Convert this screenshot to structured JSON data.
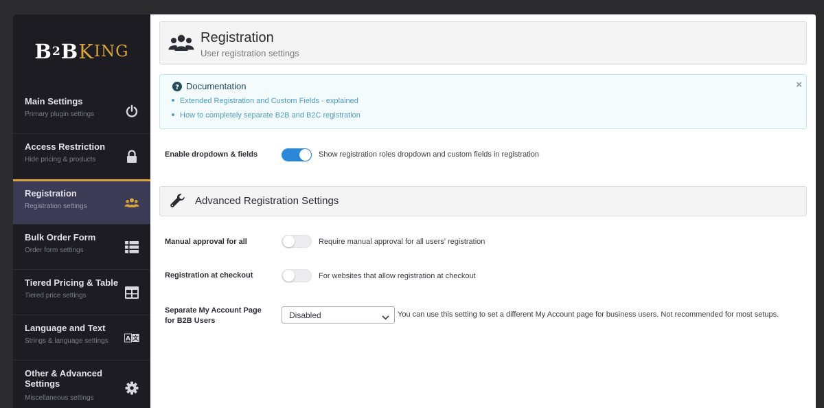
{
  "logo": {
    "b": "B",
    "two": "2",
    "b2": "B",
    "k": "K",
    "ing": "ING"
  },
  "sidebar": {
    "items": [
      {
        "title": "Main Settings",
        "subtitle": "Primary plugin settings",
        "icon": "power-icon"
      },
      {
        "title": "Access Restriction",
        "subtitle": "Hide pricing & products",
        "icon": "lock-icon"
      },
      {
        "title": "Registration",
        "subtitle": "Registration settings",
        "icon": "users-icon",
        "active": true
      },
      {
        "title": "Bulk Order Form",
        "subtitle": "Order form settings",
        "icon": "list-icon"
      },
      {
        "title": "Tiered Pricing & Table",
        "subtitle": "Tiered price settings",
        "icon": "table-icon"
      },
      {
        "title": "Language and Text",
        "subtitle": "Strings & language settings",
        "icon": "translate-icon"
      },
      {
        "title": "Other & Advanced Settings",
        "subtitle": "Miscellaneous settings",
        "icon": "gear-icon"
      }
    ]
  },
  "header": {
    "title": "Registration",
    "subtitle": "User registration settings",
    "icon": "users-icon"
  },
  "documentation": {
    "title": "Documentation",
    "close": "×",
    "links": [
      "Extended Registration and Custom Fields - explained",
      "How to completely separate B2B and B2C registration"
    ]
  },
  "settings": {
    "enable_dropdown": {
      "label": "Enable dropdown & fields",
      "enabled": true,
      "description": "Show registration roles dropdown and custom fields in registration"
    },
    "manual_approval": {
      "label": "Manual approval for all",
      "enabled": false,
      "description": "Require manual approval for all users' registration"
    },
    "registration_checkout": {
      "label": "Registration at checkout",
      "enabled": false,
      "description": "For websites that allow registration at checkout"
    },
    "separate_account": {
      "label_line1": "Separate My Account Page",
      "label_line2": "for B2B Users",
      "selected": "Disabled",
      "description": "You can use this setting to set a different My Account page for business users. Not recommended for most setups."
    }
  },
  "advanced": {
    "title": "Advanced Registration Settings",
    "icon": "wrench-icon"
  },
  "colors": {
    "accent": "#d9a53c",
    "toggle_on": "#2b88d8",
    "link": "#4f9cc0",
    "sidebar_bg": "#1c1c22",
    "active_bg": "#3b3b55"
  }
}
